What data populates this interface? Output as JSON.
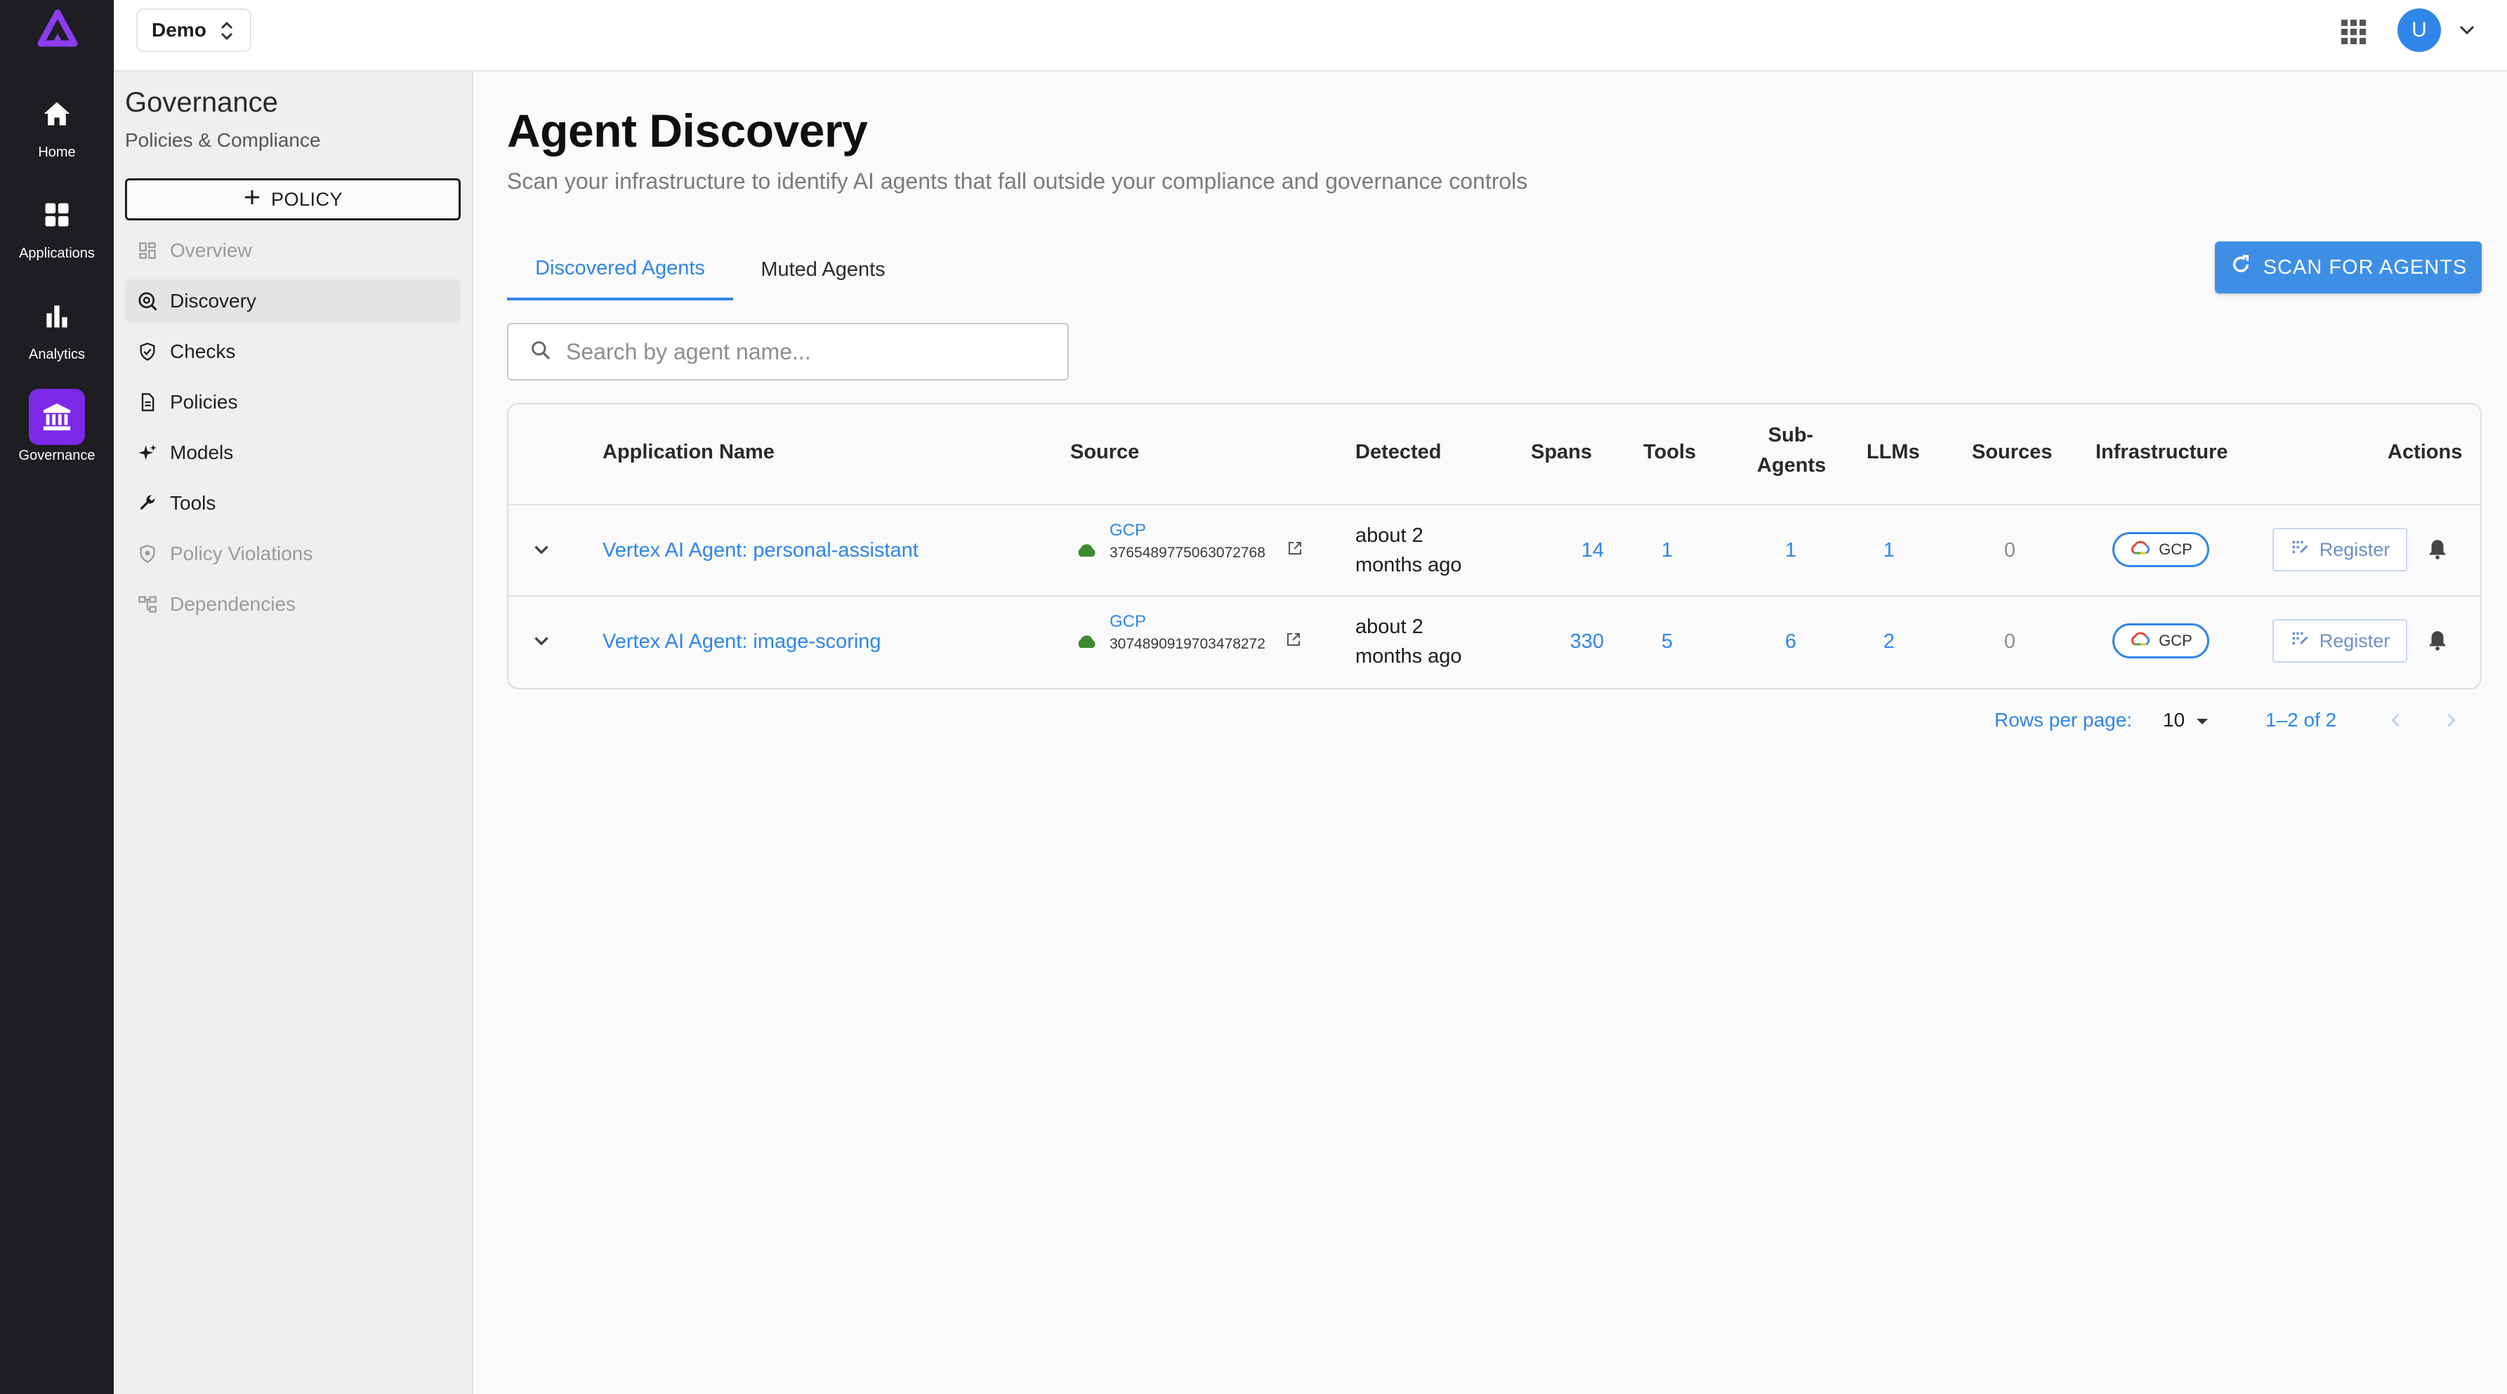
{
  "rail": {
    "items": [
      {
        "label": "Home",
        "icon": "home-icon"
      },
      {
        "label": "Applications",
        "icon": "grid-icon"
      },
      {
        "label": "Analytics",
        "icon": "bar-chart-icon"
      },
      {
        "label": "Governance",
        "icon": "bank-icon"
      }
    ],
    "active": "Governance",
    "accent": "#7c2ae8"
  },
  "topbar": {
    "org": "Demo",
    "avatar_initial": "U"
  },
  "sidebar": {
    "title": "Governance",
    "subtitle": "Policies & Compliance",
    "new_policy_label": "POLICY",
    "items": [
      {
        "label": "Overview",
        "icon": "dashboard-icon",
        "state": "disabled"
      },
      {
        "label": "Discovery",
        "icon": "radar-icon",
        "state": "active"
      },
      {
        "label": "Checks",
        "icon": "shield-check-icon",
        "state": "normal"
      },
      {
        "label": "Policies",
        "icon": "document-icon",
        "state": "normal"
      },
      {
        "label": "Models",
        "icon": "sparkle-icon",
        "state": "normal"
      },
      {
        "label": "Tools",
        "icon": "wrench-icon",
        "state": "normal"
      },
      {
        "label": "Policy Violations",
        "icon": "shield-icon",
        "state": "disabled"
      },
      {
        "label": "Dependencies",
        "icon": "hierarchy-icon",
        "state": "disabled"
      }
    ]
  },
  "main": {
    "title": "Agent Discovery",
    "subtitle": "Scan your infrastructure to identify AI agents that fall outside your compliance and governance controls",
    "tabs": [
      {
        "label": "Discovered Agents",
        "active": true
      },
      {
        "label": "Muted Agents",
        "active": false
      }
    ],
    "scan_button": "SCAN FOR AGENTS",
    "search_placeholder": "Search by agent name...",
    "accent": "#2f86e8"
  },
  "table": {
    "headers": {
      "app": "Application Name",
      "source": "Source",
      "detected": "Detected",
      "spans": "Spans",
      "tools": "Tools",
      "subagents_1": "Sub-",
      "subagents_2": "Agents",
      "llms": "LLMs",
      "sources": "Sources",
      "infra": "Infrastructure",
      "actions": "Actions"
    },
    "rows": [
      {
        "name": "Vertex AI Agent: personal-assistant",
        "source_label": "GCP",
        "source_id": "3765489775063072768",
        "detected_1": "about 2",
        "detected_2": "months ago",
        "spans": "14",
        "tools": "1",
        "subagents": "1",
        "llms": "1",
        "sources": "0",
        "infra": "GCP",
        "action": "Register"
      },
      {
        "name": "Vertex AI Agent: image-scoring",
        "source_label": "GCP",
        "source_id": "3074890919703478272",
        "detected_1": "about 2",
        "detected_2": "months ago",
        "spans": "330",
        "tools": "5",
        "subagents": "6",
        "llms": "2",
        "sources": "0",
        "infra": "GCP",
        "action": "Register"
      }
    ]
  },
  "pagination": {
    "rows_per_page_label": "Rows per page:",
    "rows_per_page": "10",
    "range": "1–2 of 2"
  }
}
